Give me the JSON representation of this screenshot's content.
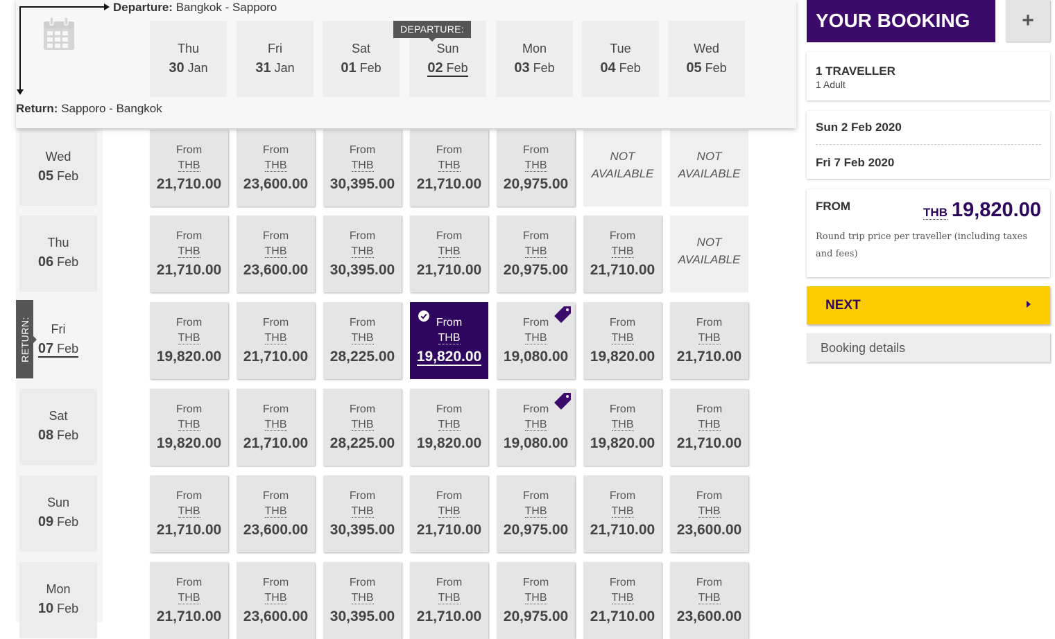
{
  "colors": {
    "accent": "#3b0a6b",
    "selected": "#2e0660",
    "next": "#fccb00"
  },
  "header": {
    "departure_label": "Departure:",
    "departure_route": "Bangkok - Sapporo",
    "return_label": "Return:",
    "return_route": "Sapporo - Bangkok",
    "departure_badge": "DEPARTURE:",
    "return_badge": "RETURN:",
    "calendar_icon": "calendar-icon"
  },
  "departure_dates": [
    {
      "dow": "Thu",
      "day": "30",
      "month": "Jan"
    },
    {
      "dow": "Fri",
      "day": "31",
      "month": "Jan"
    },
    {
      "dow": "Sat",
      "day": "01",
      "month": "Feb"
    },
    {
      "dow": "Sun",
      "day": "02",
      "month": "Feb",
      "selected": true
    },
    {
      "dow": "Mon",
      "day": "03",
      "month": "Feb"
    },
    {
      "dow": "Tue",
      "day": "04",
      "month": "Feb"
    },
    {
      "dow": "Wed",
      "day": "05",
      "month": "Feb"
    }
  ],
  "return_dates": [
    {
      "dow": "Wed",
      "day": "05",
      "month": "Feb"
    },
    {
      "dow": "Thu",
      "day": "06",
      "month": "Feb"
    },
    {
      "dow": "Fri",
      "day": "07",
      "month": "Feb",
      "selected": true
    },
    {
      "dow": "Sat",
      "day": "08",
      "month": "Feb"
    },
    {
      "dow": "Sun",
      "day": "09",
      "month": "Feb"
    },
    {
      "dow": "Mon",
      "day": "10",
      "month": "Feb"
    }
  ],
  "matrix": {
    "from_label": "From",
    "currency": "THB",
    "not_available": "NOT AVAILABLE",
    "rows": [
      [
        "21,710.00",
        "23,600.00",
        "30,395.00",
        "21,710.00",
        "20,975.00",
        null,
        null
      ],
      [
        "21,710.00",
        "23,600.00",
        "30,395.00",
        "21,710.00",
        "20,975.00",
        "21,710.00",
        null
      ],
      [
        "19,820.00",
        "21,710.00",
        "28,225.00",
        "19,820.00",
        "19,080.00",
        "19,820.00",
        "21,710.00"
      ],
      [
        "19,820.00",
        "21,710.00",
        "28,225.00",
        "19,820.00",
        "19,080.00",
        "19,820.00",
        "21,710.00"
      ],
      [
        "21,710.00",
        "23,600.00",
        "30,395.00",
        "21,710.00",
        "20,975.00",
        "21,710.00",
        "23,600.00"
      ],
      [
        "21,710.00",
        "23,600.00",
        "30,395.00",
        "21,710.00",
        "20,975.00",
        "21,710.00",
        "23,600.00"
      ]
    ],
    "selected": [
      2,
      3
    ],
    "deals": [
      [
        2,
        4
      ],
      [
        3,
        4
      ]
    ]
  },
  "booking": {
    "title": "YOUR BOOKING",
    "plus": "+",
    "traveller_count": "1 TRAVELLER",
    "traveller_detail": "1 Adult",
    "outbound_date": "Sun 2 Feb 2020",
    "return_date": "Fri 7 Feb 2020",
    "from_label": "FROM",
    "total_currency": "THB",
    "total_amount": "19,820.00",
    "price_note": "Round trip price per traveller (including taxes and fees)",
    "next_label": "NEXT",
    "details_label": "Booking details"
  }
}
